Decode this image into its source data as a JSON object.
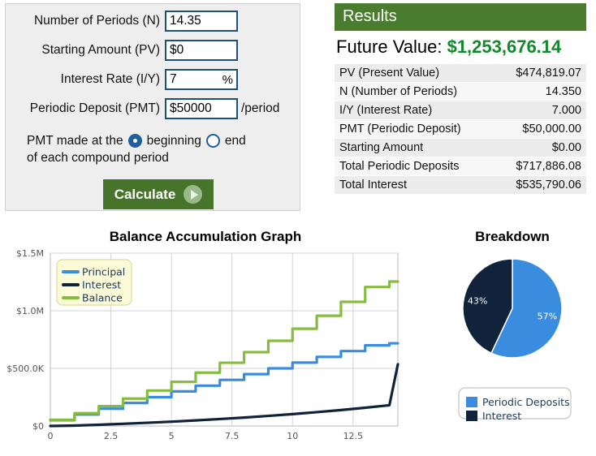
{
  "form": {
    "fields": [
      {
        "label": "Number of Periods (N)",
        "value": "14.35",
        "suffix": ""
      },
      {
        "label": "Starting Amount (PV)",
        "value": "$0",
        "suffix": ""
      },
      {
        "label": "Interest Rate (I/Y)",
        "value": "7",
        "unit": "%",
        "suffix": ""
      },
      {
        "label": "Periodic Deposit (PMT)",
        "value": "$50000",
        "suffix": "/period"
      }
    ],
    "timing": {
      "prefix": "PMT made at the",
      "option_beginning": "beginning",
      "option_end": "end",
      "line2": "of each compound period",
      "selected": "beginning"
    },
    "calculate_label": "Calculate"
  },
  "results": {
    "header": "Results",
    "future_value_label": "Future Value:",
    "future_value_amount": "$1,253,676.14",
    "rows": [
      {
        "label": "PV (Present Value)",
        "value": "$474,819.07"
      },
      {
        "label": "N (Number of Periods)",
        "value": "14.350"
      },
      {
        "label": "I/Y (Interest Rate)",
        "value": "7.000"
      },
      {
        "label": "PMT (Periodic Deposit)",
        "value": "$50,000.00"
      },
      {
        "label": "Starting Amount",
        "value": "$0.00"
      },
      {
        "label": "Total Periodic Deposits",
        "value": "$717,886.08"
      },
      {
        "label": "Total Interest",
        "value": "$535,790.06"
      }
    ]
  },
  "colors": {
    "principal": "#3a8dde",
    "interest": "#10233b",
    "balance": "#86bc40",
    "results_header": "#4a7c2f",
    "future_value": "#128a2c",
    "button": "#45742a"
  },
  "chart_data": [
    {
      "type": "line",
      "title": "Balance Accumulation Graph",
      "xlabel": "",
      "ylabel": "",
      "xlim": [
        0,
        14.35
      ],
      "ylim": [
        0,
        1500000
      ],
      "grid": true,
      "legend_position": "top-left",
      "xticks": [
        0,
        2.5,
        5,
        7.5,
        10,
        12.5
      ],
      "xticklabels": [
        "0",
        "2.5",
        "5",
        "7.5",
        "10",
        "12.5"
      ],
      "yticks": [
        0,
        500000,
        1000000,
        1500000
      ],
      "yticklabels": [
        "$0",
        "$500.0K",
        "$1.0M",
        "$1.5M"
      ],
      "series": [
        {
          "name": "Principal",
          "step": true,
          "x": [
            0,
            1,
            2,
            3,
            4,
            5,
            6,
            7,
            8,
            9,
            10,
            11,
            12,
            13,
            14,
            14.35
          ],
          "values": [
            50000,
            100000,
            150000,
            200000,
            250000,
            300000,
            350000,
            400000,
            450000,
            500000,
            550000,
            600000,
            650000,
            700000,
            717886,
            717886
          ]
        },
        {
          "name": "Interest",
          "step": false,
          "x": [
            0,
            1,
            2,
            3,
            4,
            5,
            6,
            7,
            8,
            9,
            10,
            11,
            12,
            13,
            14,
            14.35
          ],
          "values": [
            0,
            3500,
            10745,
            18800,
            27716,
            37556,
            48385,
            60272,
            73291,
            87521,
            103047,
            119960,
            138357,
            158342,
            180026,
            535790
          ]
        },
        {
          "name": "Balance",
          "step": true,
          "x": [
            0,
            1,
            2,
            3,
            4,
            5,
            6,
            7,
            8,
            9,
            10,
            11,
            12,
            13,
            14,
            14.35
          ],
          "values": [
            53500,
            110745,
            171997,
            237537,
            307665,
            382701,
            462990,
            548899,
            640822,
            739180,
            844423,
            957033,
            1077525,
            1206452,
            1253676,
            1253676
          ]
        }
      ]
    },
    {
      "type": "pie",
      "title": "Breakdown",
      "labels": [
        "Periodic Deposits",
        "Interest"
      ],
      "values": [
        57,
        43
      ],
      "value_labels": [
        "57%",
        "43%"
      ],
      "colors": [
        "#3a8dde",
        "#10233b"
      ],
      "legend_position": "bottom"
    }
  ]
}
